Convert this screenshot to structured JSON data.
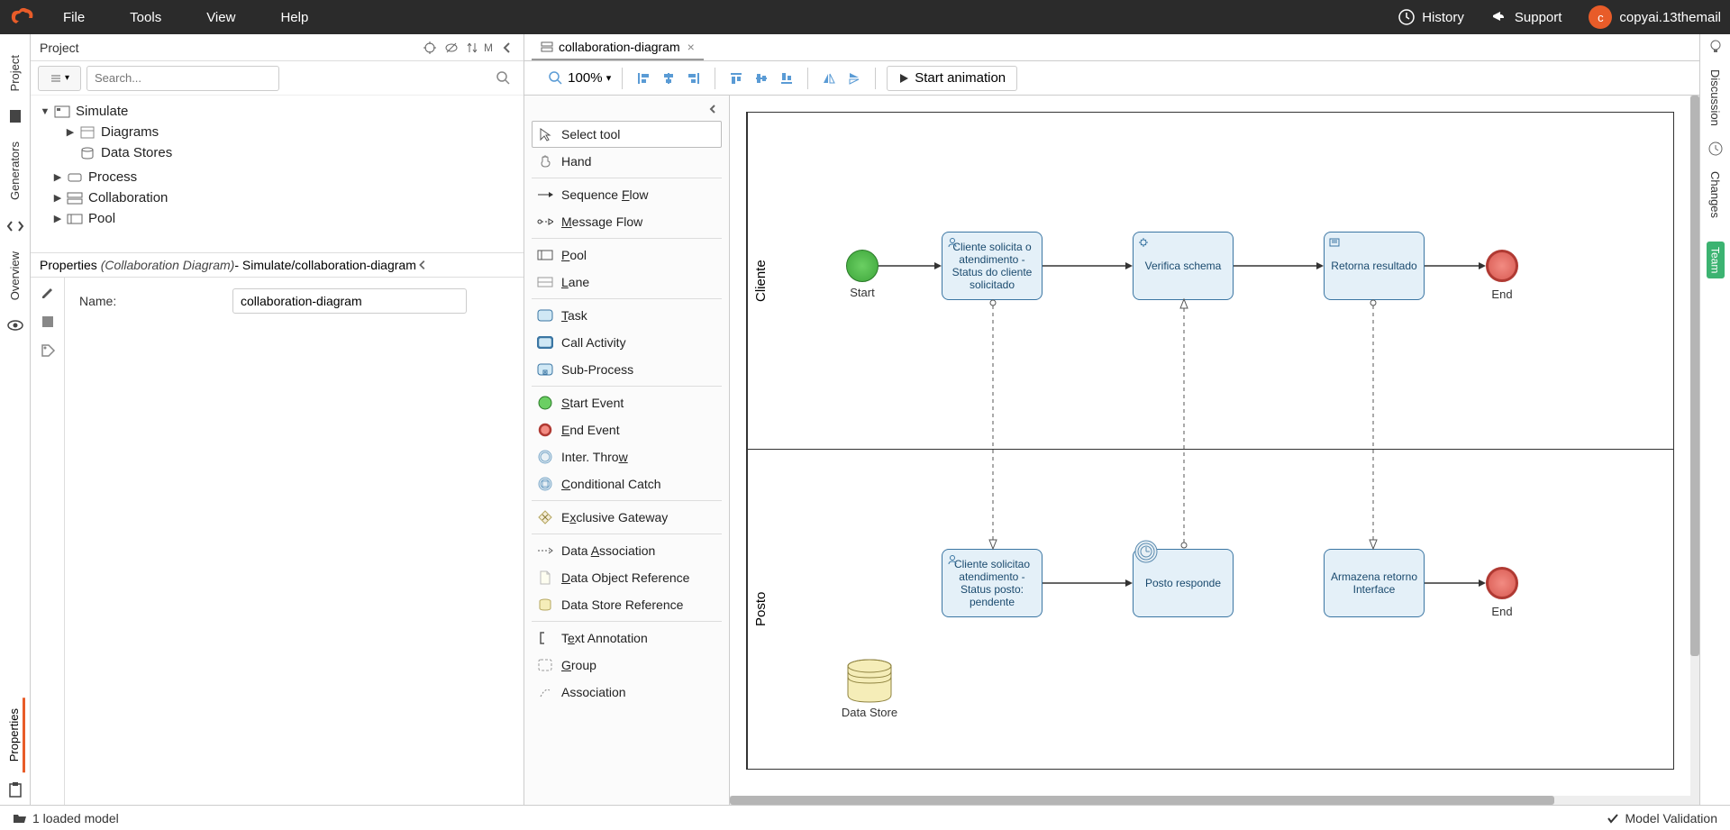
{
  "top_menu": {
    "items": [
      "File",
      "Tools",
      "View",
      "Help"
    ],
    "history": "History",
    "support": "Support",
    "user": "copyai.13themail",
    "avatar_letter": "c"
  },
  "left_rail": {
    "items": [
      "Project",
      "Generators",
      "Overview"
    ],
    "properties_tab": "Properties"
  },
  "project_panel": {
    "title": "Project",
    "search_placeholder": "Search...",
    "tree": {
      "root": "Simulate",
      "diagrams": "Diagrams",
      "datastores": "Data Stores",
      "process": "Process",
      "collaboration": "Collaboration",
      "pool": "Pool"
    }
  },
  "properties_panel": {
    "prefix": "Properties",
    "type": "(Collaboration Diagram)",
    "path": " - Simulate/collaboration-diagram",
    "name_label": "Name:",
    "name_value": "collaboration-diagram"
  },
  "tab": {
    "label": "collaboration-diagram"
  },
  "toolbar": {
    "zoom": "100%",
    "start_animation": "Start animation"
  },
  "palette": {
    "select_tool": "Select tool",
    "hand": "Hand",
    "sequence_flow": "Sequence Flow",
    "message_flow": "Message Flow",
    "pool": "Pool",
    "lane": "Lane",
    "task": "Task",
    "call_activity": "Call Activity",
    "sub_process": "Sub-Process",
    "start_event": "Start Event",
    "end_event": "End Event",
    "inter_throw": "Inter. Throw",
    "conditional_catch": "Conditional Catch",
    "exclusive_gateway": "Exclusive Gateway",
    "data_association": "Data Association",
    "data_object_ref": "Data Object Reference",
    "data_store_ref": "Data Store Reference",
    "text_annotation": "Text Annotation",
    "group": "Group",
    "association": "Association"
  },
  "diagram": {
    "pool1_label": "Cliente",
    "pool2_label": "Posto",
    "start_label": "Start",
    "end_label": "End",
    "task1": "Cliente solicita o atendimento - Status do cliente solicitado",
    "task2": "Verifica schema",
    "task3": "Retorna resultado",
    "task4": "Cliente solicitao atendimento - Status posto: pendente",
    "task5": "Posto responde",
    "task6": "Armazena retorno Interface",
    "datastore_label": "Data Store"
  },
  "right_rail": {
    "discussion": "Discussion",
    "changes": "Changes",
    "team": "Team"
  },
  "status_bar": {
    "loaded": "1 loaded model",
    "validation": "Model Validation"
  }
}
